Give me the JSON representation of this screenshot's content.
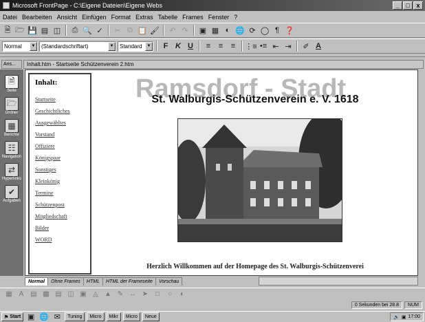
{
  "window": {
    "title": "Microsoft FrontPage - C:\\Eigene Dateien\\Eigene Webs",
    "controls": [
      "_",
      "□",
      "x"
    ]
  },
  "menu": [
    "Datei",
    "Bearbeiten",
    "Ansicht",
    "Einfügen",
    "Format",
    "Extras",
    "Tabelle",
    "Frames",
    "Fenster",
    "?"
  ],
  "format_toolbar": {
    "style": "Normal",
    "font": "(Standardschriftart)",
    "size": "Standard",
    "bold": "F",
    "italic": "K",
    "underline": "U"
  },
  "ansichten_label": "Ans...",
  "path": "Inhalt.htm - Startseite Schützenverein 2.htm",
  "views": [
    {
      "label": "Seite",
      "icon": "page-icon"
    },
    {
      "label": "Ordner",
      "icon": "folder-icon"
    },
    {
      "label": "Berichte",
      "icon": "reports-icon"
    },
    {
      "label": "Navigation",
      "icon": "navigation-icon"
    },
    {
      "label": "Hyperlinks",
      "icon": "hyperlinks-icon"
    },
    {
      "label": "Aufgaben",
      "icon": "tasks-icon"
    }
  ],
  "left_frame": {
    "heading": "Inhalt:",
    "links": [
      "Startseite",
      "Geschichtliches",
      "Ausgewähltes",
      "Vorstand",
      "Offiziere",
      "Königspaar",
      "Sonstiges",
      "Kleinkönig",
      "Termine",
      "Schützenpost",
      "Mitgliedschaft",
      "Bilder",
      "WORD"
    ]
  },
  "main_frame": {
    "background_title": "Ramsdorf - Stadt",
    "title": "St. Walburgis-Schützenverein e. V. 1618",
    "welcome": "Herzlich Willkommen auf der Homepage des St. Walburgis-Schützenverei"
  },
  "tabs": [
    "Normal",
    "Ohne Frames",
    "HTML",
    "HTML der Frameseite",
    "Vorschau"
  ],
  "status": {
    "time_estimate": "0 Sekunden bei 28.8",
    "mode": "NUM"
  },
  "taskbar": {
    "start": "Start",
    "apps": [
      "Tuning",
      "Micro",
      "Mikr",
      "Micro",
      "Neue"
    ],
    "clock": "17:00"
  }
}
